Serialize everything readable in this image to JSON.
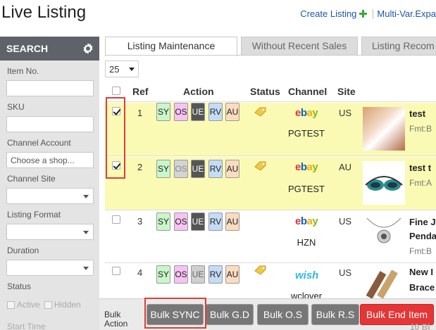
{
  "header": {
    "title": "Live Listing",
    "create_listing": "Create Listing",
    "multi_var": "Multi-Var.Expa"
  },
  "sidebar": {
    "heading": "SEARCH",
    "item_no_label": "Item No.",
    "sku_label": "SKU",
    "channel_account_label": "Channel Account",
    "channel_account_placeholder": "Choose a shop...",
    "channel_site_label": "Channel Site",
    "listing_format_label": "Listing Format",
    "duration_label": "Duration",
    "status_label": "Status",
    "status_active": "Active",
    "status_hidden": "Hidden",
    "start_time_label": "Start Time"
  },
  "tabs": [
    "Listing Maintenance",
    "Without Recent Sales",
    "Listing Recom"
  ],
  "per_page": "25",
  "table": {
    "headers": {
      "ref": "Ref",
      "action": "Action",
      "status": "Status",
      "channel": "Channel",
      "site": "Site"
    },
    "actions": [
      "SY",
      "OS",
      "UE",
      "RV",
      "AU"
    ],
    "rows": [
      {
        "ref": "1",
        "checked": true,
        "channel": "ebay",
        "account": "PGTEST",
        "site": "US",
        "title1": "test",
        "title2": "",
        "fmt": "Fmt:B"
      },
      {
        "ref": "2",
        "checked": true,
        "channel": "ebay",
        "account": "PGTEST",
        "site": "AU",
        "title1": "test t",
        "title2": "",
        "fmt": "Fmt:A"
      },
      {
        "ref": "3",
        "checked": false,
        "channel": "ebay",
        "account": "HZN",
        "site": "US",
        "title1": "Fine J",
        "title2": "Penda",
        "fmt": "Fmt:B"
      },
      {
        "ref": "4",
        "checked": false,
        "channel": "wish",
        "account": "wclover",
        "site": "US",
        "title1": "New I",
        "title2": "Brace",
        "fmt": ""
      }
    ],
    "next_row_partial": "10 Bl"
  },
  "bulk": {
    "label_line1": "Bulk",
    "label_line2": "Action",
    "buttons": [
      "Bulk SYNC",
      "Bulk G.D",
      "Bulk O.S",
      "Bulk R.S",
      "Bulk End Item"
    ]
  },
  "colors": {
    "highlight": "#d9403a",
    "selected_row": "#fafab4",
    "end_button": "#e53535"
  }
}
